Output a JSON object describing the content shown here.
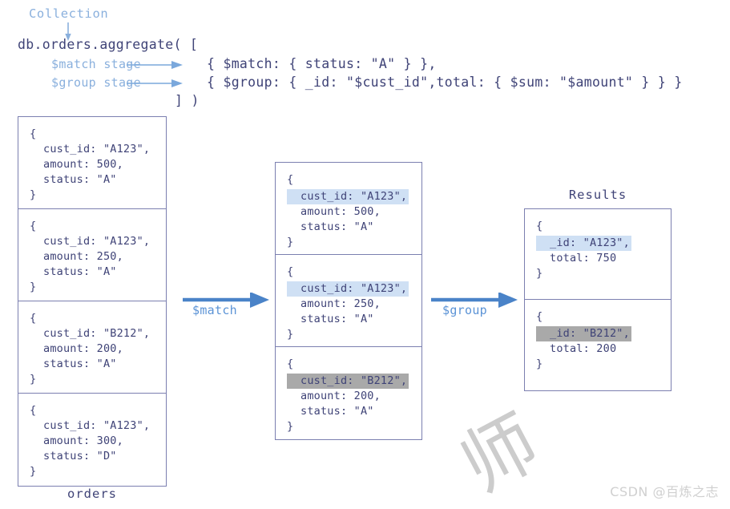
{
  "code": {
    "collection_label": "Collection",
    "lines": [
      "db.orders.aggregate( [",
      "{ $match: { status: \"A\" } },",
      "{ $group: { _id: \"$cust_id\",total: { $sum: \"$amount\" } } }",
      "] )"
    ],
    "stage_labels": {
      "match": "$match stage",
      "group": "$group stage"
    }
  },
  "flow": {
    "match_label": "$match",
    "group_label": "$group"
  },
  "columns": {
    "orders": {
      "caption": "orders",
      "docs": [
        {
          "open": "{",
          "cust_id": "cust_id: \"A123\",",
          "amount": "amount: 500,",
          "status": "status: \"A\"",
          "close": "}",
          "highlight": "none"
        },
        {
          "open": "{",
          "cust_id": "cust_id: \"A123\",",
          "amount": "amount: 250,",
          "status": "status: \"A\"",
          "close": "}",
          "highlight": "none"
        },
        {
          "open": "{",
          "cust_id": "cust_id: \"B212\",",
          "amount": "amount: 200,",
          "status": "status: \"A\"",
          "close": "}",
          "highlight": "none"
        },
        {
          "open": "{",
          "cust_id": "cust_id: \"A123\",",
          "amount": "amount: 300,",
          "status": "status: \"D\"",
          "close": "}",
          "highlight": "none"
        }
      ]
    },
    "matched": {
      "caption": "",
      "docs": [
        {
          "open": "{",
          "cust_id": "cust_id: \"A123\",",
          "amount": "amount: 500,",
          "status": "status: \"A\"",
          "close": "}",
          "highlight": "blue"
        },
        {
          "open": "{",
          "cust_id": "cust_id: \"A123\",",
          "amount": "amount: 250,",
          "status": "status: \"A\"",
          "close": "}",
          "highlight": "blue"
        },
        {
          "open": "{",
          "cust_id": "cust_id: \"B212\",",
          "amount": "amount: 200,",
          "status": "status: \"A\"",
          "close": "}",
          "highlight": "gray"
        }
      ]
    },
    "results": {
      "caption": "Results",
      "docs": [
        {
          "open": "{",
          "id": "_id: \"A123\",",
          "total": "total: 750",
          "close": "}",
          "highlight": "blue"
        },
        {
          "open": "{",
          "id": "_id: \"B212\",",
          "total": "total: 200",
          "close": "}",
          "highlight": "gray"
        }
      ]
    }
  },
  "watermark": {
    "glyph": "师",
    "csdn": "CSDN @百炼之志"
  },
  "colors": {
    "text": "#3f4377",
    "label": "#8ab0dd",
    "arrow": "#5b93d6",
    "border": "#7b7fb0",
    "highlight_blue": "#cfe0f4",
    "highlight_gray": "#a9a9a9"
  }
}
